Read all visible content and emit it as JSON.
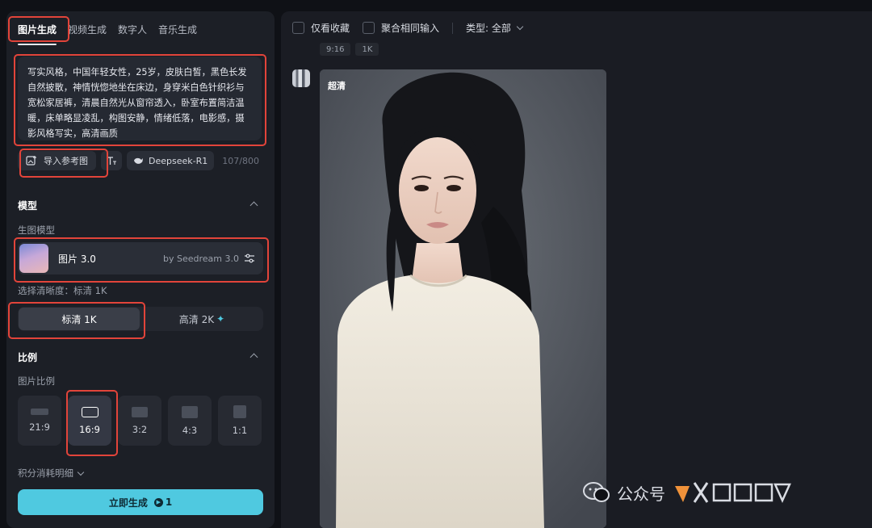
{
  "tabs": [
    "图片生成",
    "视频生成",
    "数字人",
    "音乐生成"
  ],
  "prompt": {
    "text": "写实风格，中国年轻女性，25岁，皮肤白皙，黑色长发自然披散，神情恍惚地坐在床边，身穿米白色针织衫与宽松家居裤，清晨自然光从窗帘透入，卧室布置简洁温暖，床单略显凌乱，构图安静，情绪低落，电影感，摄影风格写实，高清画质"
  },
  "tools": {
    "import_ref": "导入参考图",
    "model_chip": "Deepseek-R1",
    "count": "107/800"
  },
  "model_section": {
    "title": "模型",
    "sublabel": "生图模型",
    "model_name": "图片 3.0",
    "model_by": "by Seedream 3.0",
    "resolution_label": "选择清晰度：标清 1K",
    "resolutions": [
      "标清 1K",
      "高清 2K"
    ]
  },
  "ratio_section": {
    "title": "比例",
    "sublabel": "图片比例",
    "ratios": [
      "21:9",
      "16:9",
      "3:2",
      "4:3",
      "1:1"
    ],
    "selected": "16:9"
  },
  "cost_detail": "积分消耗明细",
  "generate": {
    "label": "立即生成",
    "cost": "1"
  },
  "filters": {
    "favorites": "仅看收藏",
    "aggregate": "聚合相同输入",
    "type_label": "类型: 全部"
  },
  "result": {
    "tags": [
      "9:16",
      "1K"
    ],
    "quality_label": "超清"
  },
  "watermark": {
    "text": "公众号"
  },
  "colors": {
    "accent": "#4fc9e0",
    "highlight_box": "#e2443a",
    "panel": "#1c1f26"
  }
}
